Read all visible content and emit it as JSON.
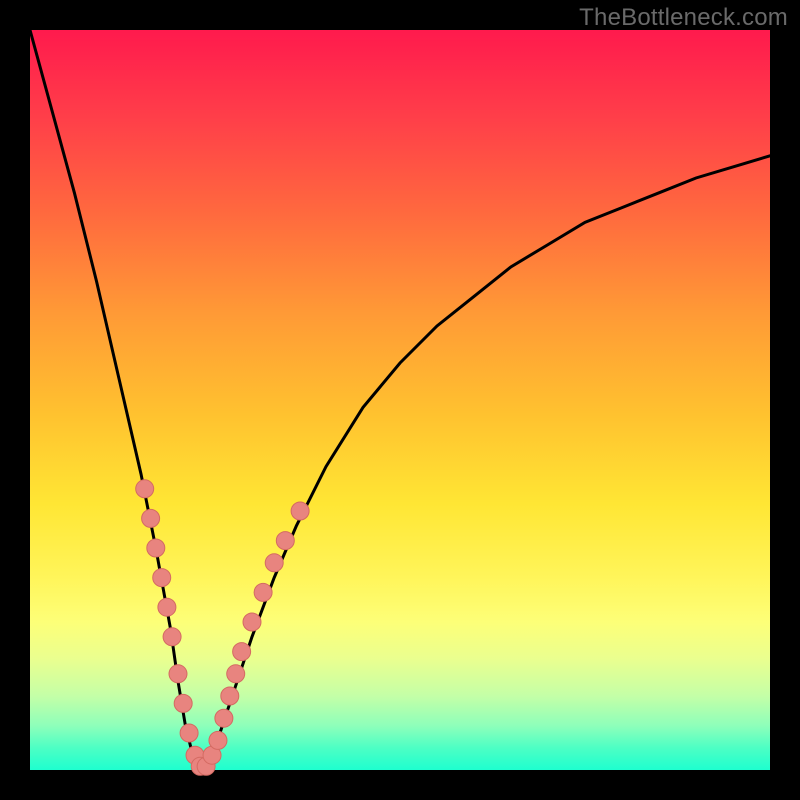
{
  "watermark": "TheBottleneck.com",
  "colors": {
    "frame": "#000000",
    "curve": "#000000",
    "dot_fill": "#e8847f",
    "dot_stroke": "#d46a62",
    "gradient_top": "#ff1a4d",
    "gradient_mid": "#ffe634",
    "gradient_bottom": "#1effcf"
  },
  "chart_data": {
    "type": "line",
    "title": "",
    "xlabel": "",
    "ylabel": "",
    "xlim": [
      0,
      100
    ],
    "ylim": [
      0,
      100
    ],
    "note": "Bottleneck-style V curve. y is bottleneck % (0 at the notch, 100 at top). Minimum near x≈23.",
    "series": [
      {
        "name": "bottleneck-curve",
        "x": [
          0,
          3,
          6,
          9,
          12,
          15,
          17,
          19,
          20,
          21,
          22,
          23,
          24,
          25,
          26,
          28,
          30,
          33,
          36,
          40,
          45,
          50,
          55,
          60,
          65,
          70,
          75,
          80,
          85,
          90,
          95,
          100
        ],
        "y": [
          100,
          89,
          78,
          66,
          53,
          40,
          30,
          19,
          12,
          6,
          2,
          0,
          1,
          3,
          6,
          12,
          18,
          26,
          33,
          41,
          49,
          55,
          60,
          64,
          68,
          71,
          74,
          76,
          78,
          80,
          81.5,
          83
        ]
      }
    ],
    "dots": {
      "name": "highlight-cluster",
      "points": [
        {
          "x": 15.5,
          "y": 38
        },
        {
          "x": 16.3,
          "y": 34
        },
        {
          "x": 17.0,
          "y": 30
        },
        {
          "x": 17.8,
          "y": 26
        },
        {
          "x": 18.5,
          "y": 22
        },
        {
          "x": 19.2,
          "y": 18
        },
        {
          "x": 20.0,
          "y": 13
        },
        {
          "x": 20.7,
          "y": 9
        },
        {
          "x": 21.5,
          "y": 5
        },
        {
          "x": 22.3,
          "y": 2
        },
        {
          "x": 23.0,
          "y": 0.5
        },
        {
          "x": 23.8,
          "y": 0.5
        },
        {
          "x": 24.6,
          "y": 2
        },
        {
          "x": 25.4,
          "y": 4
        },
        {
          "x": 26.2,
          "y": 7
        },
        {
          "x": 27.0,
          "y": 10
        },
        {
          "x": 27.8,
          "y": 13
        },
        {
          "x": 28.6,
          "y": 16
        },
        {
          "x": 30.0,
          "y": 20
        },
        {
          "x": 31.5,
          "y": 24
        },
        {
          "x": 33.0,
          "y": 28
        },
        {
          "x": 34.5,
          "y": 31
        },
        {
          "x": 36.5,
          "y": 35
        }
      ]
    }
  }
}
